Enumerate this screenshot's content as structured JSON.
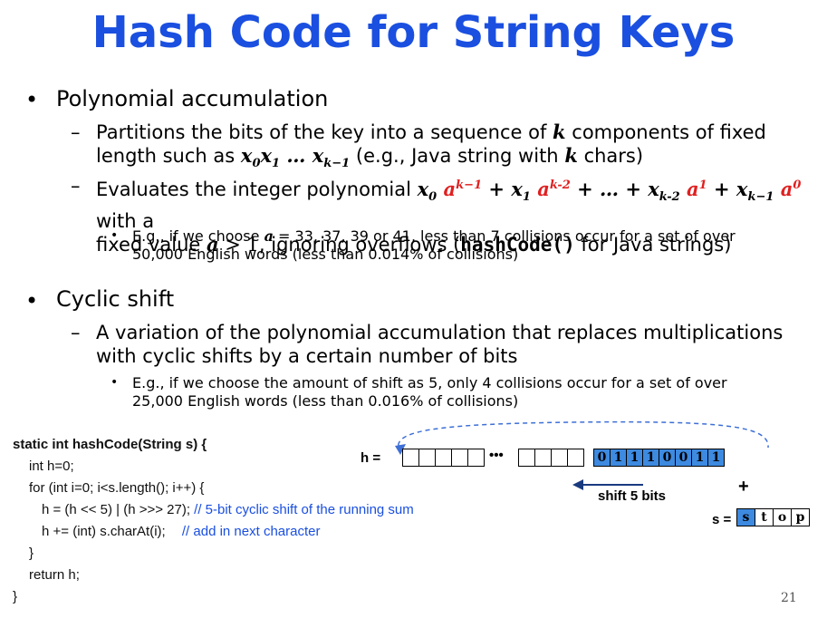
{
  "title": "Hash Code for String Keys",
  "bullet1": {
    "heading": "Polynomial accumulation",
    "sub1_a": "Partitions the bits of the key into a sequence of",
    "sub1_k": "k",
    "sub1_b": "components of fixed",
    "sub1_c": "length such as",
    "sub1_d": "(e.g., Java string with",
    "sub1_e": "chars)",
    "sub2_a": "Evaluates the integer polynomial",
    "sub2_b": "with a",
    "sub2_c": "fixed value",
    "sub2_d": ", ignoring overflows (",
    "sub2_code": "hashCode()",
    "sub2_e": "for Java strings)",
    "eg": "E.g., if we choose",
    "eg2": "= 33, 37, 39 or 41, less than 7 collisions occur for a set of over",
    "eg3": "50,000 English words (less than 0.014% of collisions)"
  },
  "bullet2": {
    "heading": "Cyclic shift",
    "sub1": "A variation of the polynomial accumulation that replaces multiplications",
    "sub1b": "with cyclic shifts by a certain number of bits",
    "eg1": "E.g., if we choose the amount of shift as 5, only 4 collisions occur for a set of over",
    "eg2": "25,000 English words (less than 0.016% of collisions)"
  },
  "code": {
    "l1": "static int hashCode(String s) {",
    "l2": "int h=0;",
    "l3": "for (int i=0; i<s.length(); i++) {",
    "l4": "h = (h << 5) | (h >>> 27);",
    "l4c": "// 5-bit cyclic shift of the running sum",
    "l5": "h += (int) s.charAt(i);",
    "l5c": "// add in next character",
    "l6": "}",
    "l7": "return h;",
    "l8": "}"
  },
  "diagram": {
    "h_label": "h =",
    "dots": "•••",
    "bits": [
      "0",
      "1",
      "1",
      "1",
      "0",
      "0",
      "1",
      "1"
    ],
    "shift_label": "shift 5 bits",
    "plus": "+",
    "s_label": "s =",
    "chars": [
      "s",
      "t",
      "o",
      "p"
    ]
  },
  "page_number": "21",
  "colors": {
    "title": "#1a4fe0",
    "highlight": "#3d8ae0",
    "accent_red": "#e02020"
  }
}
